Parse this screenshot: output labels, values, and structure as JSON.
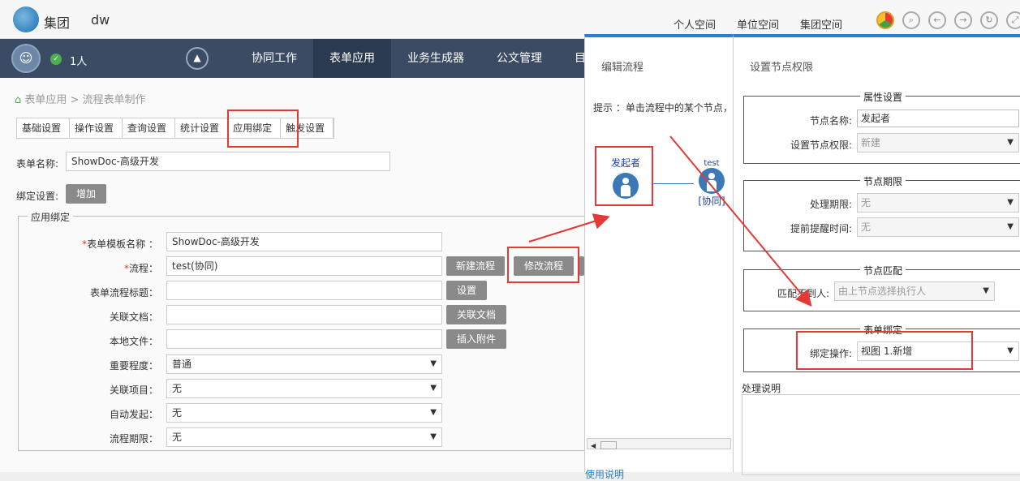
{
  "topbar": {
    "logo_text": "集团",
    "user_code": "dw",
    "links": [
      "个人空间",
      "单位空间",
      "集团空间"
    ],
    "icons": [
      "chrome-icon",
      "search-icon",
      "back-icon",
      "forward-icon",
      "refresh-icon",
      "fullscreen-icon"
    ]
  },
  "navbar": {
    "online_count": "1人",
    "items": [
      "协同工作",
      "表单应用",
      "业务生成器",
      "公文管理",
      "目"
    ],
    "active": "表单应用"
  },
  "breadcrumb": "表单应用 > 流程表单制作",
  "tabs": [
    "基础设置",
    "操作设置",
    "查询设置",
    "统计设置",
    "应用绑定",
    "触发设置"
  ],
  "form": {
    "name_label": "表单名称:",
    "name_value": "ShowDoc-高级开发",
    "bind_label": "绑定设置:",
    "add_button": "增加",
    "legend": "应用绑定",
    "rows": [
      {
        "label": "*表单模板名称 ：",
        "value": "ShowDoc-高级开发",
        "required": true
      },
      {
        "label": "*流程：",
        "value": "test(协同)",
        "required": true
      },
      {
        "label": "表单流程标题：",
        "value": ""
      },
      {
        "label": "关联文档：",
        "value": ""
      },
      {
        "label": "本地文件：",
        "value": ""
      },
      {
        "label": "重要程度：",
        "value": "普通",
        "select": true
      },
      {
        "label": "关联项目：",
        "value": "无",
        "select": true
      },
      {
        "label": "自动发起：",
        "value": "无",
        "select": true
      },
      {
        "label": "流程期限：",
        "value": "无",
        "select": true
      }
    ],
    "buttons": {
      "new_flow": "新建流程",
      "edit_flow": "修改流程",
      "settings": "设置",
      "related_doc": "关联文档",
      "insert_attach": "插入附件"
    }
  },
  "dialog_flow": {
    "title": "编辑流程",
    "hint": "提示 ：单击流程中的某个节点，",
    "node1": "发起者",
    "node2_top": "test",
    "node2_bottom": "[协同]",
    "footer": "使用说明"
  },
  "dialog_perm": {
    "title": "设置节点权限",
    "attr_title": "属性设置",
    "node_name_label": "节点名称:",
    "node_name_value": "发起者",
    "perm_label": "设置节点权限:",
    "perm_value": "新建",
    "deadline_title": "节点期限",
    "process_label": "处理期限:",
    "process_value": "无",
    "remind_label": "提前提醒时间:",
    "remind_value": "无",
    "match_title": "节点匹配",
    "nomatch_label": "匹配不到人:",
    "nomatch_value": "由上节点选择执行人",
    "bind_title": "表单绑定",
    "bind_label": "绑定操作:",
    "bind_value": "视图 1.新增",
    "desc_label": "处理说明"
  }
}
